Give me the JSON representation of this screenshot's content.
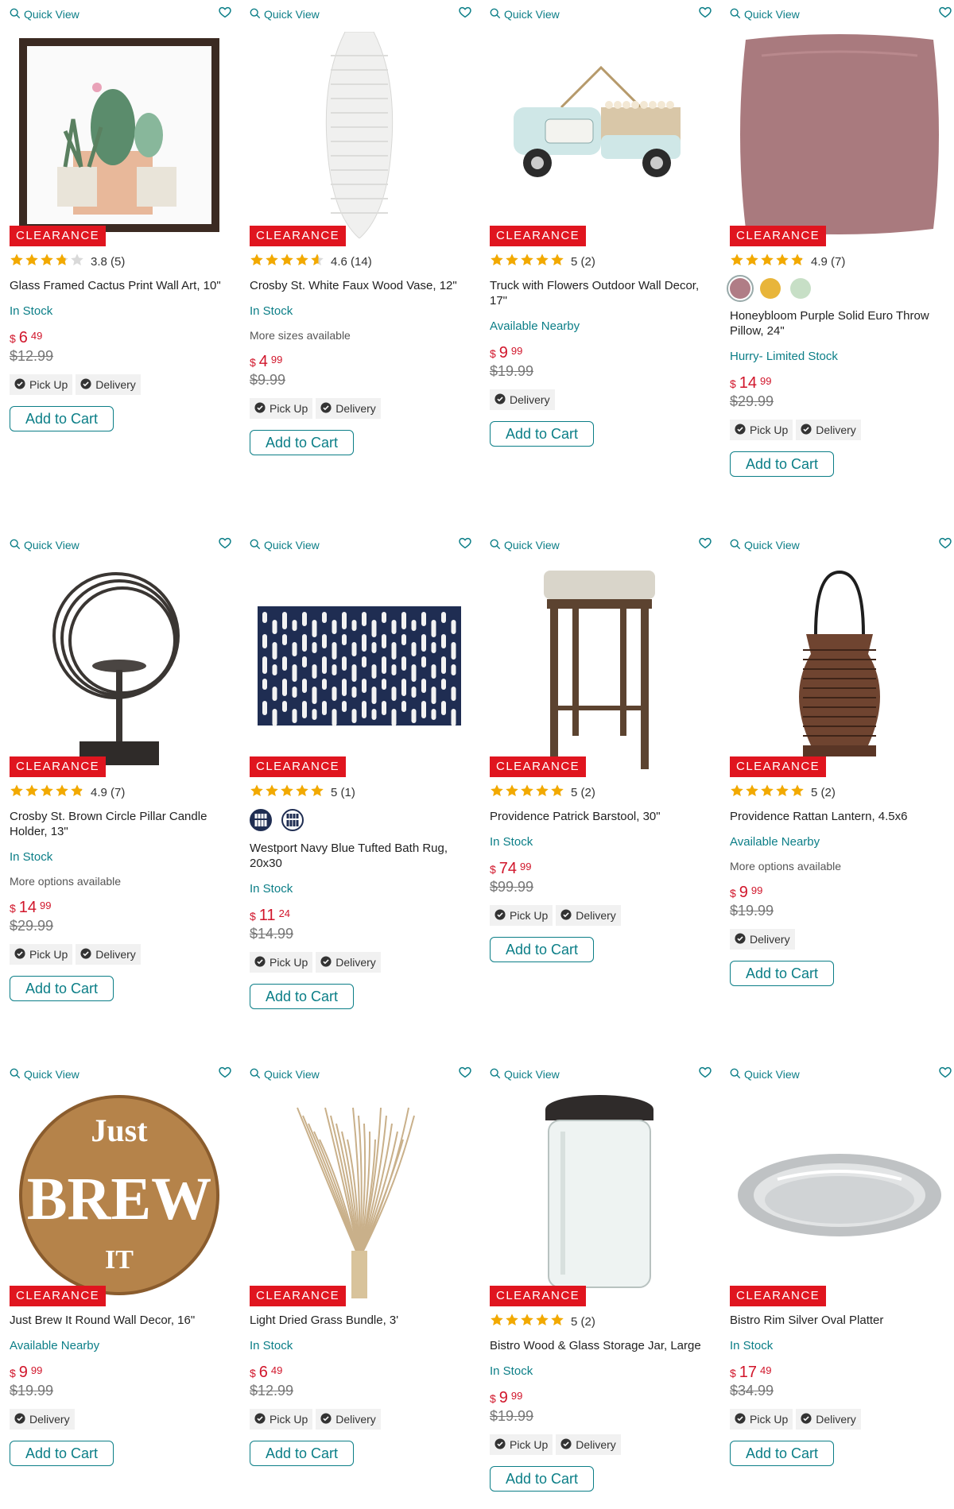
{
  "quick_view_label": "Quick View",
  "badge_label": "CLEARANCE",
  "add_to_cart_label": "Add to Cart",
  "pickup_label": "Pick Up",
  "delivery_label": "Delivery",
  "colors": {
    "accent": "#0b7e87",
    "badge": "#e0151f",
    "price": "#d1162b",
    "star": "#f2a900"
  },
  "products": [
    {
      "rating": 3.8,
      "rating_text": "3.8 (5)",
      "title": "Glass Framed Cactus Print Wall Art, 10\"",
      "stock": "In Stock",
      "more": "",
      "currency": "$",
      "dollars": "6",
      "cents": "49",
      "was": "$12.99",
      "pickup": true,
      "delivery": true,
      "image": "cactus-wall-art"
    },
    {
      "rating": 4.6,
      "rating_text": "4.6 (14)",
      "title": "Crosby St. White Faux Wood Vase, 12\"",
      "stock": "In Stock",
      "more": "More sizes available",
      "currency": "$",
      "dollars": "4",
      "cents": "99",
      "was": "$9.99",
      "pickup": true,
      "delivery": true,
      "image": "white-vase"
    },
    {
      "rating": 5,
      "rating_text": "5 (2)",
      "title": "Truck with Flowers Outdoor Wall Decor, 17\"",
      "stock": "Available Nearby",
      "more": "",
      "currency": "$",
      "dollars": "9",
      "cents": "99",
      "was": "$19.99",
      "pickup": false,
      "delivery": true,
      "image": "truck-decor"
    },
    {
      "rating": 4.9,
      "rating_text": "4.9 (7)",
      "title": "Honeybloom Purple Solid Euro Throw Pillow, 24\"",
      "stock": "Hurry- Limited Stock",
      "more": "",
      "currency": "$",
      "dollars": "14",
      "cents": "99",
      "was": "$29.99",
      "pickup": true,
      "delivery": true,
      "image": "purple-pillow",
      "swatches": [
        "#b07d86",
        "#e8b53a",
        "#c7dfc6"
      ]
    },
    {
      "rating": 4.9,
      "rating_text": "4.9 (7)",
      "title": "Crosby St. Brown Circle Pillar Candle Holder, 13\"",
      "stock": "In Stock",
      "more": "More options available",
      "currency": "$",
      "dollars": "14",
      "cents": "99",
      "was": "$29.99",
      "pickup": true,
      "delivery": true,
      "image": "circle-candle-holder"
    },
    {
      "rating": 5,
      "rating_text": "5 (1)",
      "title": "Westport Navy Blue Tufted Bath Rug, 20x30",
      "stock": "In Stock",
      "more": "",
      "currency": "$",
      "dollars": "11",
      "cents": "24",
      "was": "$14.99",
      "pickup": true,
      "delivery": true,
      "image": "navy-bath-rug",
      "pattern_swatches": true
    },
    {
      "rating": 5,
      "rating_text": "5 (2)",
      "title": "Providence Patrick Barstool, 30\"",
      "stock": "In Stock",
      "more": "",
      "currency": "$",
      "dollars": "74",
      "cents": "99",
      "was": "$99.99",
      "pickup": true,
      "delivery": true,
      "image": "barstool"
    },
    {
      "rating": 5,
      "rating_text": "5 (2)",
      "title": "Providence Rattan Lantern, 4.5x6",
      "stock": "Available Nearby",
      "more": "More options available",
      "currency": "$",
      "dollars": "9",
      "cents": "99",
      "was": "$19.99",
      "pickup": false,
      "delivery": true,
      "image": "rattan-lantern"
    },
    {
      "rating": 0,
      "rating_text": "",
      "title": "Just Brew It Round Wall Decor, 16\"",
      "stock": "Available Nearby",
      "more": "",
      "currency": "$",
      "dollars": "9",
      "cents": "99",
      "was": "$19.99",
      "pickup": false,
      "delivery": true,
      "image": "just-brew-it-sign",
      "sign_text": [
        "Just",
        "BREW",
        "IT"
      ]
    },
    {
      "rating": 0,
      "rating_text": "",
      "title": "Light Dried Grass Bundle, 3'",
      "stock": "In Stock",
      "more": "",
      "currency": "$",
      "dollars": "6",
      "cents": "49",
      "was": "$12.99",
      "pickup": true,
      "delivery": true,
      "image": "dried-grass"
    },
    {
      "rating": 5,
      "rating_text": "5 (2)",
      "title": "Bistro Wood & Glass Storage Jar, Large",
      "stock": "In Stock",
      "more": "",
      "currency": "$",
      "dollars": "9",
      "cents": "99",
      "was": "$19.99",
      "pickup": true,
      "delivery": true,
      "image": "glass-jar"
    },
    {
      "rating": 0,
      "rating_text": "",
      "title": "Bistro Rim Silver Oval Platter",
      "stock": "In Stock",
      "more": "",
      "currency": "$",
      "dollars": "17",
      "cents": "49",
      "was": "$34.99",
      "pickup": true,
      "delivery": true,
      "image": "silver-platter"
    }
  ]
}
